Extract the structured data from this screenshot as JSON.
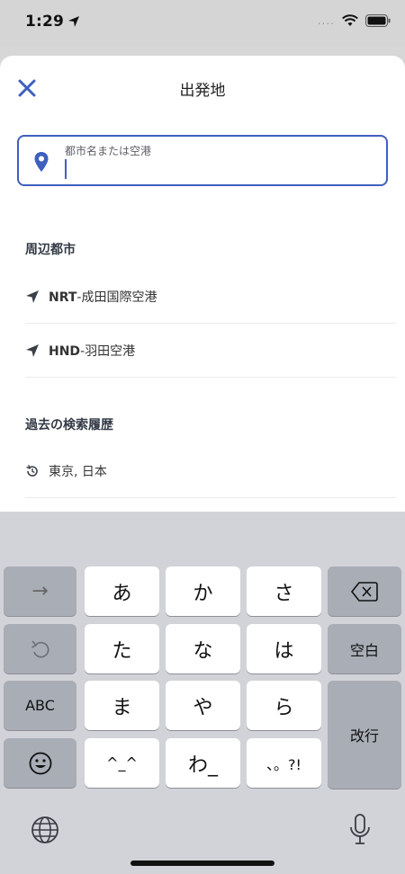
{
  "status": {
    "time": "1:29",
    "dots": "...."
  },
  "header": {
    "title": "出発地"
  },
  "search": {
    "label": "都市名または空港",
    "value": ""
  },
  "nearby": {
    "title": "周辺都市",
    "items": [
      {
        "code": "NRT",
        "name": "-成田国際空港"
      },
      {
        "code": "HND",
        "name": "-羽田空港"
      }
    ]
  },
  "history": {
    "title": "過去の検索履歴",
    "items": [
      {
        "name": "東京, 日本"
      }
    ]
  },
  "keyboard": {
    "row1": [
      "あ",
      "か",
      "さ"
    ],
    "row2": [
      "た",
      "な",
      "は"
    ],
    "row3": [
      "ま",
      "や",
      "ら"
    ],
    "row4": [
      "^_^",
      "わ_",
      "、。?!"
    ],
    "arrow": "→",
    "abc": "ABC",
    "space": "空白",
    "enter": "改行"
  },
  "colors": {
    "accent": "#3f5fbf"
  }
}
